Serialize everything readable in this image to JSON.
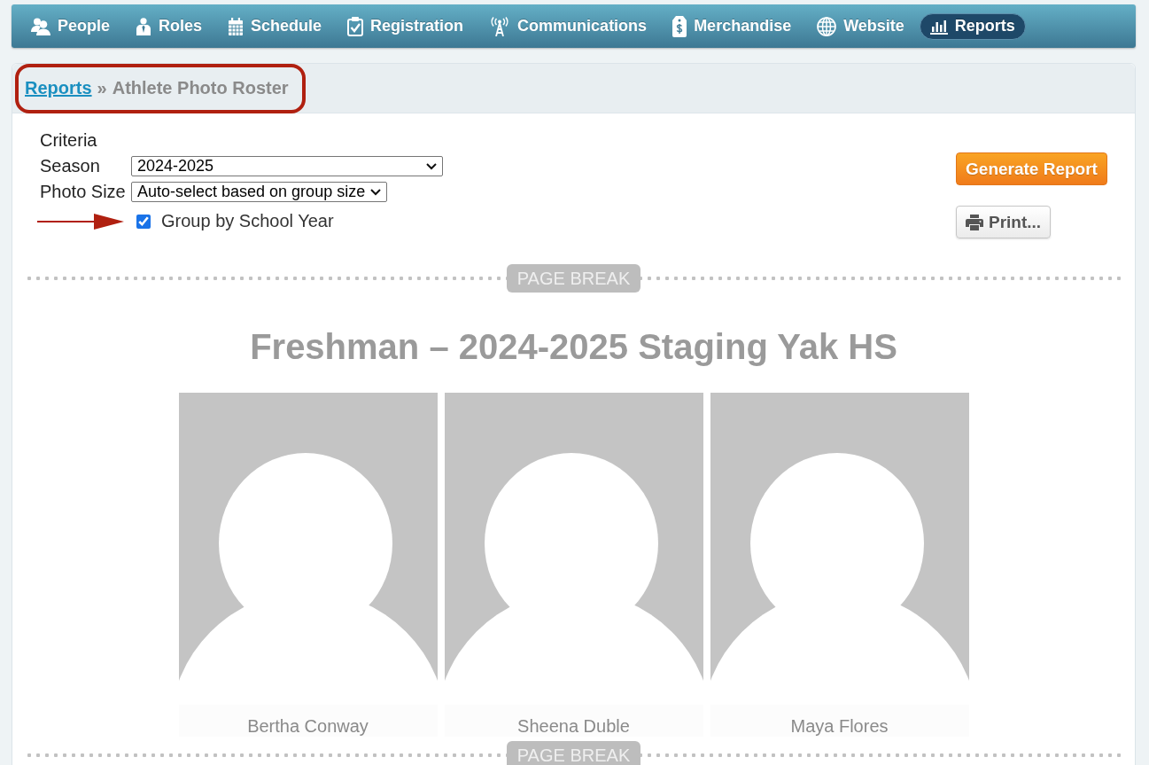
{
  "nav_bar": {
    "tabs": [
      {
        "label": "People",
        "selected": false
      },
      {
        "label": "Roles",
        "selected": false
      },
      {
        "label": "Schedule",
        "selected": false
      },
      {
        "label": "Registration",
        "selected": false
      },
      {
        "label": "Communications",
        "selected": false
      },
      {
        "label": "Merchandise",
        "selected": false
      },
      {
        "label": "Website",
        "selected": false
      },
      {
        "label": "Reports",
        "selected": true
      }
    ]
  },
  "breadcrumb": {
    "link": "Reports",
    "separator": "»",
    "current": "Athlete Photo Roster",
    "circled": true
  },
  "criteria": {
    "heading": "Criteria",
    "fields": [
      {
        "kind": "select",
        "label": "Season",
        "value": "2024-2025"
      },
      {
        "kind": "select",
        "label": "Photo Size",
        "value": "Auto-select based on group size"
      },
      {
        "kind": "checkbox",
        "label": "Group by School Year",
        "checked": true,
        "arrow_pointer": true
      }
    ]
  },
  "actions": [
    {
      "kind": "primary",
      "label": "Generate Report"
    },
    {
      "kind": "print",
      "label": "Print..."
    }
  ],
  "report": {
    "blocks": [
      {
        "kind": "page_break",
        "label": "PAGE BREAK"
      },
      {
        "kind": "group",
        "title": "Freshman – 2024-2025 Staging Yak HS",
        "athletes": [
          {
            "name": "Bertha Conway"
          },
          {
            "name": "Sheena Duble"
          },
          {
            "name": "Maya Flores"
          }
        ]
      },
      {
        "kind": "page_break",
        "label": "PAGE BREAK"
      }
    ]
  }
}
